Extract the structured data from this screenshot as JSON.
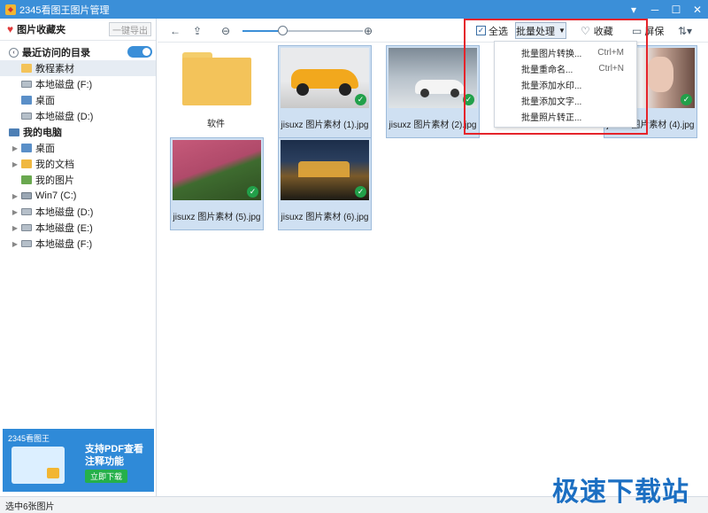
{
  "window": {
    "title": "2345看图王图片管理"
  },
  "sidebar": {
    "favorites_title": "图片收藏夹",
    "export_label": "一键导出",
    "recent_title": "最近访问的目录",
    "recent": [
      {
        "label": "教程素材",
        "icon": "folder"
      },
      {
        "label": "本地磁盘 (F:)",
        "icon": "drive"
      },
      {
        "label": "桌面",
        "icon": "desktop"
      },
      {
        "label": "本地磁盘 (D:)",
        "icon": "drive"
      }
    ],
    "pc_title": "我的电脑",
    "pc": [
      {
        "label": "桌面",
        "icon": "desktop"
      },
      {
        "label": "我的文档",
        "icon": "documents"
      },
      {
        "label": "我的图片",
        "icon": "pictures"
      },
      {
        "label": "Win7 (C:)",
        "icon": "drive"
      },
      {
        "label": "本地磁盘 (D:)",
        "icon": "drive"
      },
      {
        "label": "本地磁盘 (E:)",
        "icon": "drive"
      },
      {
        "label": "本地磁盘 (F:)",
        "icon": "drive"
      }
    ]
  },
  "ad": {
    "brand": "2345看图王",
    "line1": "支持PDF查看",
    "line2": "注释功能",
    "button": "立即下载"
  },
  "toolbar": {
    "select_all": "全选",
    "batch": "批量处理",
    "favorite": "收藏",
    "screen": "屏保"
  },
  "batch_menu": [
    {
      "label": "批量图片转换...",
      "shortcut": "Ctrl+M"
    },
    {
      "label": "批量重命名...",
      "shortcut": "Ctrl+N"
    },
    {
      "label": "批量添加水印...",
      "shortcut": ""
    },
    {
      "label": "批量添加文字...",
      "shortcut": ""
    },
    {
      "label": "批量照片转正...",
      "shortcut": ""
    }
  ],
  "files": [
    {
      "name": "软件",
      "type": "folder"
    },
    {
      "name": "jisuxz 图片素材 (1).jpg",
      "type": "image"
    },
    {
      "name": "jisuxz 图片素材 (2).jpg",
      "type": "image"
    },
    {
      "name": "jisuxz 图片素材 (4).jpg",
      "type": "image"
    },
    {
      "name": "jisuxz 图片素材 (5).jpg",
      "type": "image"
    },
    {
      "name": "jisuxz 图片素材 (6).jpg",
      "type": "image"
    }
  ],
  "status": "选中6张图片",
  "watermark": "极速下载站",
  "colors": {
    "titlebar": "#3b8fd8",
    "accent": "#3b8fd8",
    "selection": "#cfe0f2",
    "highlight_box": "#e5242b"
  }
}
